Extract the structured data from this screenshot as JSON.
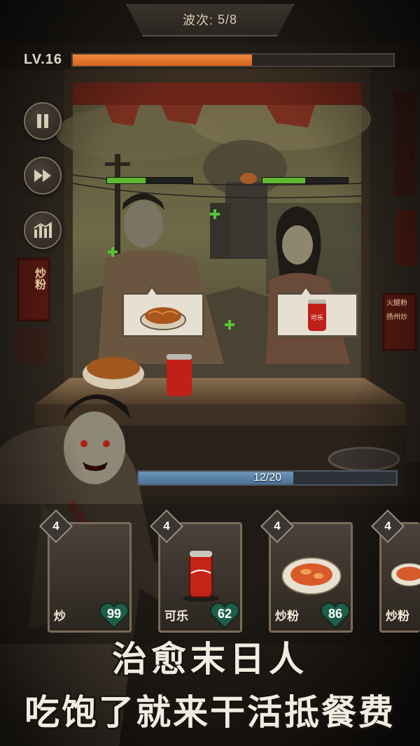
{
  "hud": {
    "wave_label": "波次:",
    "wave_value": "5/8",
    "level_label": "LV.16",
    "level_progress": 0.56
  },
  "controls": {
    "pause": "pause-icon",
    "fast_forward": "fast-forward-icon",
    "stats": "stats-chart-icon"
  },
  "customers": [
    {
      "hp": 0.45,
      "order_item": "炒粉"
    },
    {
      "hp": 0.5,
      "order_item": "可乐"
    }
  ],
  "signs": {
    "left_sign": "炒粉",
    "right_sign_1": "火腿粉",
    "right_sign_2": "扬州炒"
  },
  "counter_items": {
    "noodles": "炒粉",
    "cola_label": "可乐"
  },
  "queue": {
    "text": "12/20",
    "progress": 0.6
  },
  "cards": [
    {
      "level": "4",
      "name": "炒",
      "price": "99"
    },
    {
      "level": "4",
      "name": "可乐",
      "price": "62"
    },
    {
      "level": "4",
      "name": "炒粉",
      "price": "86"
    },
    {
      "level": "4",
      "name": "炒粉",
      "price": ""
    }
  ],
  "slogan": {
    "line1": "治愈末日人",
    "line2": "吃饱了就来干活抵餐费"
  },
  "colors": {
    "level_fill": "#e8762a",
    "hp_fill": "#5fb832",
    "queue_fill": "#5a82a8",
    "price_heart": "#1f5e48"
  }
}
